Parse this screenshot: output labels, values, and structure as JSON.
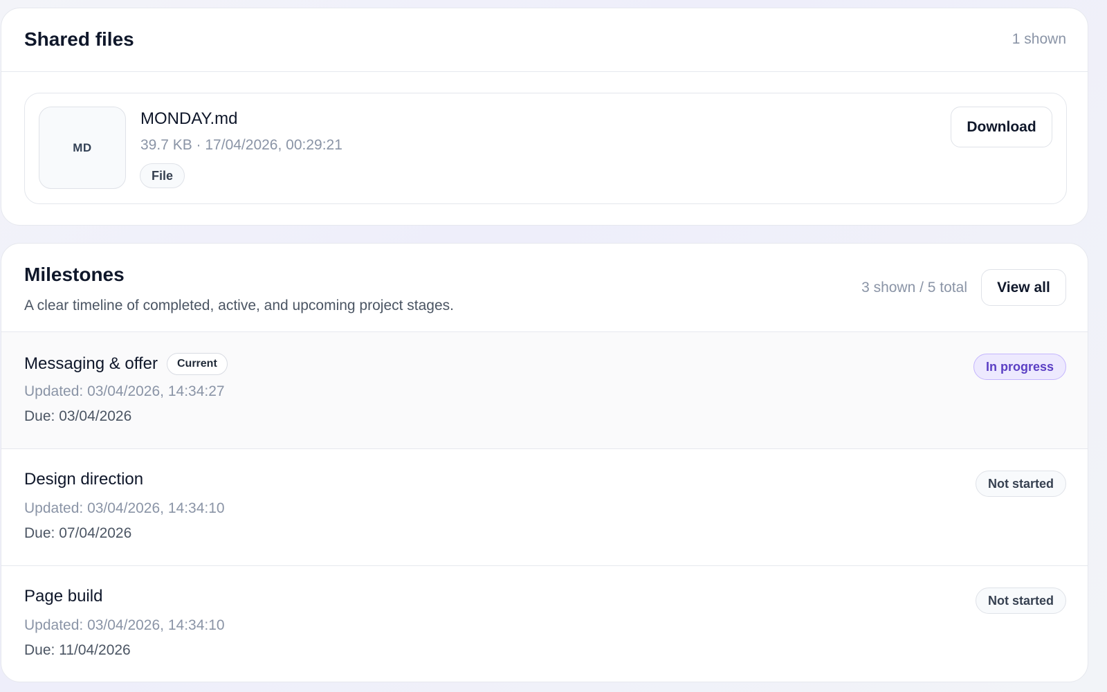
{
  "shared_files": {
    "title": "Shared files",
    "count_label": "1 shown",
    "files": [
      {
        "thumb_label": "MD",
        "name": "MONDAY.md",
        "meta": "39.7 KB · 17/04/2026, 00:29:21",
        "type_chip": "File",
        "download_label": "Download"
      }
    ]
  },
  "milestones": {
    "title": "Milestones",
    "subtitle": "A clear timeline of completed, active, and upcoming project stages.",
    "count_label": "3 shown / 5 total",
    "view_all_label": "View all",
    "items": [
      {
        "title": "Messaging & offer",
        "current_tag": "Current",
        "updated": "Updated: 03/04/2026, 14:34:27",
        "due": "Due: 03/04/2026",
        "status": "In progress"
      },
      {
        "title": "Design direction",
        "updated": "Updated: 03/04/2026, 14:34:10",
        "due": "Due: 07/04/2026",
        "status": "Not started"
      },
      {
        "title": "Page build",
        "updated": "Updated: 03/04/2026, 14:34:10",
        "due": "Due: 11/04/2026",
        "status": "Not started"
      }
    ]
  },
  "colors": {
    "accent_purple": "#5b3fc4",
    "in_progress_bg": "#ede9fe",
    "muted_text": "#8a94a6",
    "border": "#e6e8ee"
  }
}
